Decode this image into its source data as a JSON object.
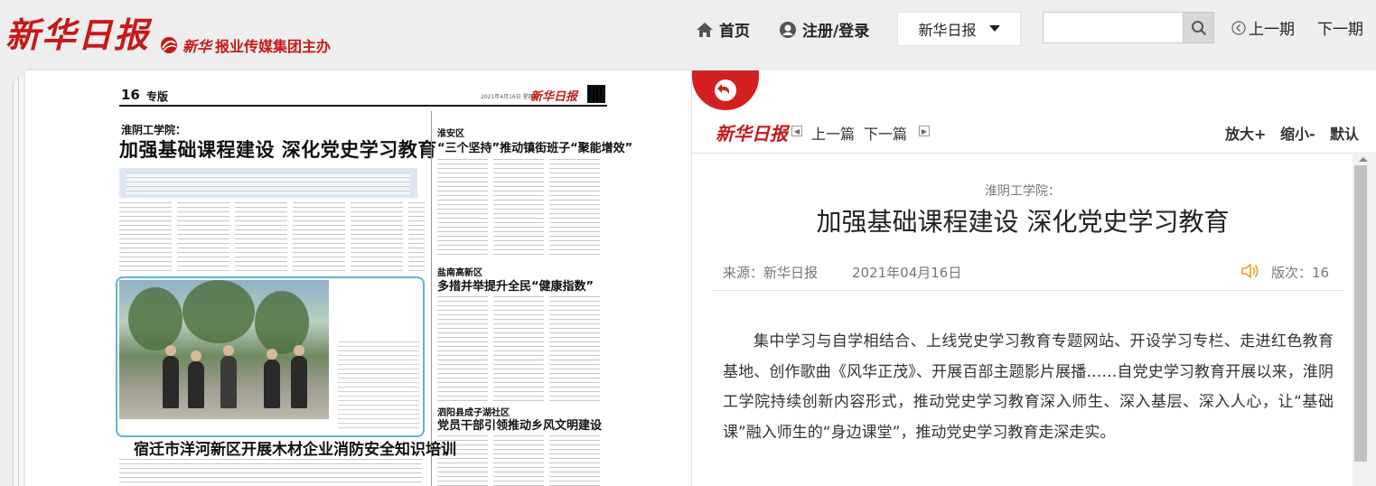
{
  "header": {
    "logo": "新华日报",
    "host_brand": "新华",
    "host_text": "报业传媒集团主办",
    "nav_home": "首页",
    "nav_login": "注册/登录",
    "paper_selected": "新华日报",
    "search_placeholder": "",
    "prev_issue": "上一期",
    "next_issue": "下一期"
  },
  "page_image": {
    "page_number": "16",
    "section": "专版",
    "date": "2021年4月16日 星期五",
    "logo": "新华日报",
    "kicker": "淮阴工学院：",
    "headline": "加强基础课程建设  深化党史学习教育",
    "side1_kicker": "淮安区",
    "side1_head": "“三个坚持”推动镇街班子“聚能增效”",
    "side2_kicker": "盐南高新区",
    "side2_head": "多措并举提升全民“健康指数”",
    "side3_kicker": "泗阳县成子湖社区",
    "side3_head": "党员干部引领推动乡风文明建设",
    "bottom_head": "宿迁市洋河新区开展木材企业消防安全知识培训"
  },
  "article": {
    "logo": "新华日报",
    "prev": "上一篇",
    "next": "下一篇",
    "zoom_in": "放大+",
    "zoom_out": "缩小-",
    "zoom_reset": "默认",
    "subtitle": "淮阴工学院：",
    "title": "加强基础课程建设 深化党史学习教育",
    "source": "来源：新华日报",
    "date": "2021年04月16日",
    "edition": "版次：16",
    "body": "集中学习与自学相结合、上线党史学习教育专题网站、开设学习专栏、走进红色教育基地、创作歌曲《风华正茂》、开展百部主题影片展播……自党史学习教育开展以来，淮阴工学院持续创新内容形式，推动党史学习教育深入师生、深入基层、深入人心，让“基础课”融入师生的“身边课堂”，推动党史学习教育走深走实。"
  },
  "colors": {
    "brand_red": "#c81818",
    "return_red": "#d42020",
    "speaker_orange": "#f0a020"
  }
}
